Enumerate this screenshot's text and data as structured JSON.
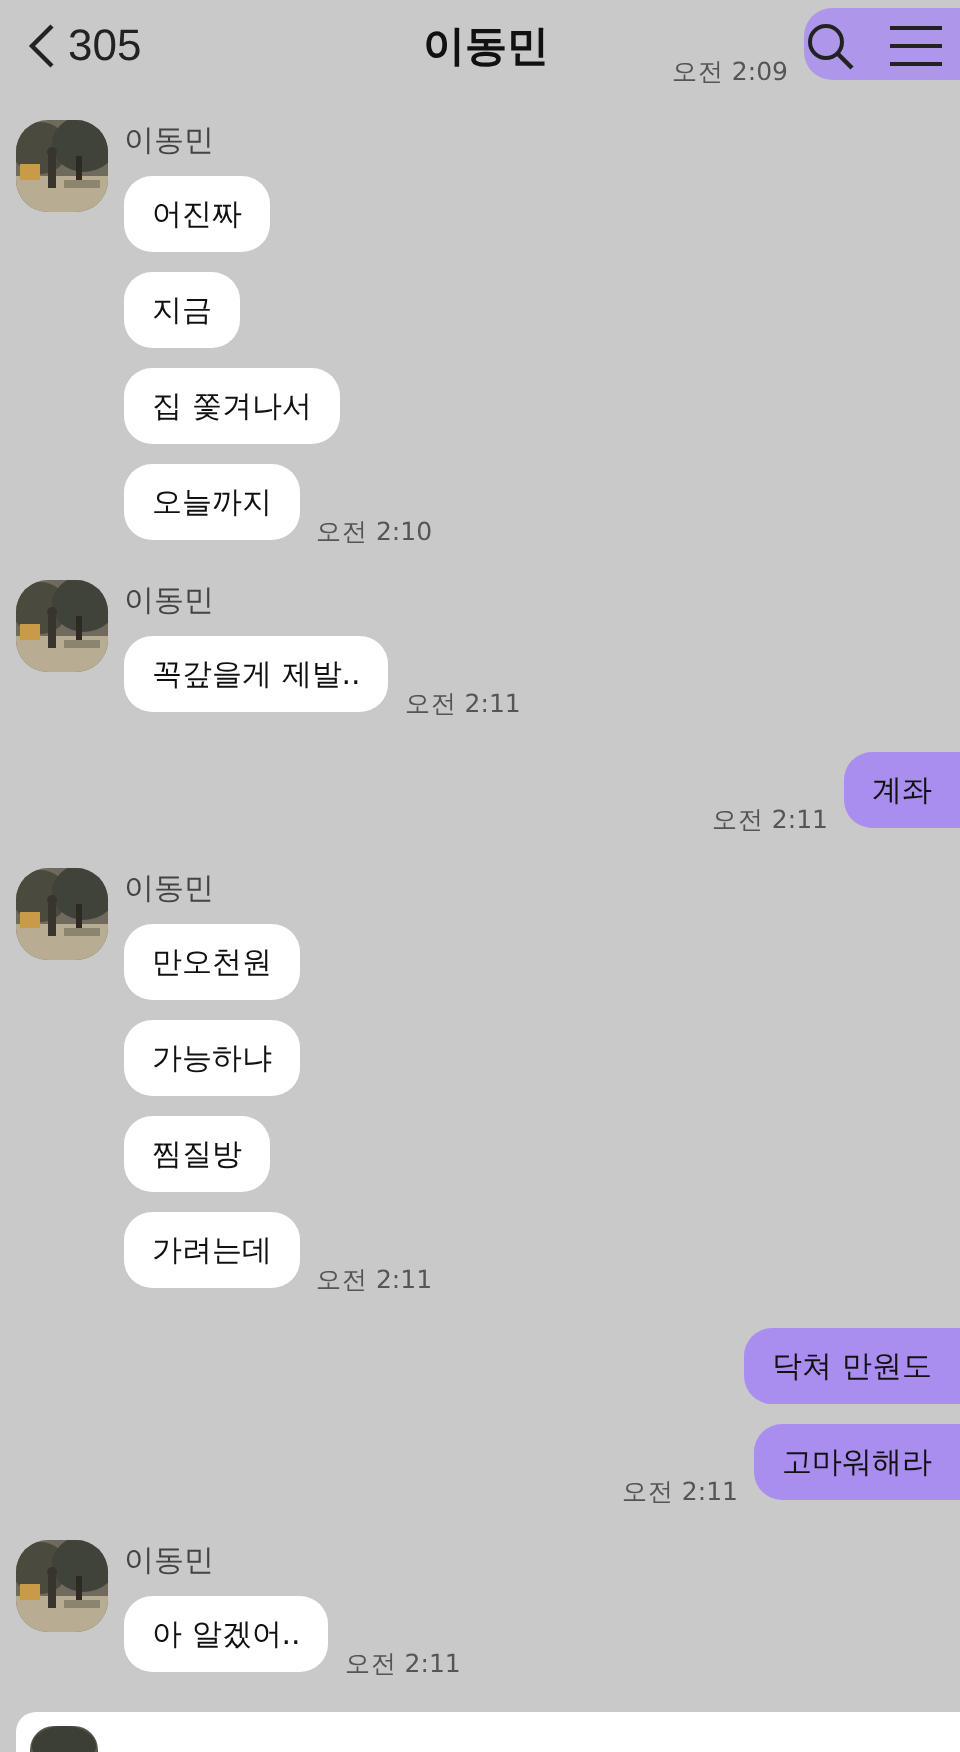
{
  "header": {
    "back_count": "305",
    "title": "이동민"
  },
  "messages": [
    {
      "kind": "sent",
      "time": "오전 2:09",
      "partial": true
    },
    {
      "kind": "received",
      "name": "이동민",
      "bubbles": [
        {
          "text": "어진짜"
        },
        {
          "text": "지금"
        },
        {
          "text": "집 쫓겨나서"
        },
        {
          "text": "오늘까지"
        }
      ],
      "time": "오전 2:10"
    },
    {
      "kind": "received",
      "name": "이동민",
      "bubbles": [
        {
          "text": "꼭갚을게 제발.."
        }
      ],
      "time": "오전 2:11"
    },
    {
      "kind": "sent",
      "bubbles": [
        {
          "text": "계좌"
        }
      ],
      "time": "오전 2:11"
    },
    {
      "kind": "received",
      "name": "이동민",
      "bubbles": [
        {
          "text": "만오천원"
        },
        {
          "text": "가능하냐"
        },
        {
          "text": "찜질방"
        },
        {
          "text": "가려는데"
        }
      ],
      "time": "오전 2:11"
    },
    {
      "kind": "sent",
      "bubbles": [
        {
          "text": "닥쳐 만원도"
        },
        {
          "text": "고마워해라"
        }
      ],
      "time": "오전 2:11"
    },
    {
      "kind": "received",
      "name": "이동민",
      "bubbles": [
        {
          "text": "아 알겠어.."
        }
      ],
      "time": "오전 2:11"
    }
  ]
}
